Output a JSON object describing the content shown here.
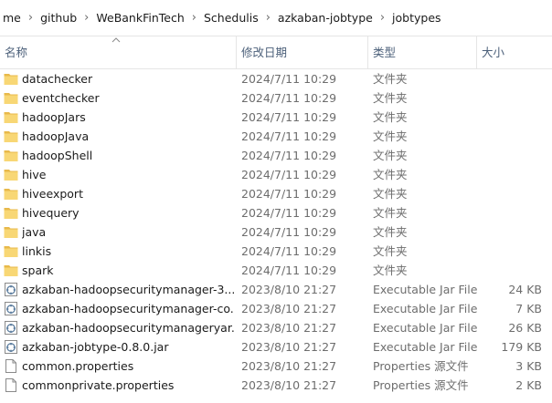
{
  "breadcrumb": [
    "me",
    "github",
    "WeBankFinTech",
    "Schedulis",
    "azkaban-jobtype",
    "jobtypes"
  ],
  "columns": {
    "name": "名称",
    "date": "修改日期",
    "type": "类型",
    "size": "大小"
  },
  "files": [
    {
      "name": "datachecker",
      "date": "2024/7/11 10:29",
      "type": "文件夹",
      "size": "",
      "icon": "folder-icon"
    },
    {
      "name": "eventchecker",
      "date": "2024/7/11 10:29",
      "type": "文件夹",
      "size": "",
      "icon": "folder-icon"
    },
    {
      "name": "hadoopJars",
      "date": "2024/7/11 10:29",
      "type": "文件夹",
      "size": "",
      "icon": "folder-icon"
    },
    {
      "name": "hadoopJava",
      "date": "2024/7/11 10:29",
      "type": "文件夹",
      "size": "",
      "icon": "folder-icon"
    },
    {
      "name": "hadoopShell",
      "date": "2024/7/11 10:29",
      "type": "文件夹",
      "size": "",
      "icon": "folder-icon"
    },
    {
      "name": "hive",
      "date": "2024/7/11 10:29",
      "type": "文件夹",
      "size": "",
      "icon": "folder-icon"
    },
    {
      "name": "hiveexport",
      "date": "2024/7/11 10:29",
      "type": "文件夹",
      "size": "",
      "icon": "folder-icon"
    },
    {
      "name": "hivequery",
      "date": "2024/7/11 10:29",
      "type": "文件夹",
      "size": "",
      "icon": "folder-icon"
    },
    {
      "name": "java",
      "date": "2024/7/11 10:29",
      "type": "文件夹",
      "size": "",
      "icon": "folder-icon"
    },
    {
      "name": "linkis",
      "date": "2024/7/11 10:29",
      "type": "文件夹",
      "size": "",
      "icon": "folder-icon"
    },
    {
      "name": "spark",
      "date": "2024/7/11 10:29",
      "type": "文件夹",
      "size": "",
      "icon": "folder-icon"
    },
    {
      "name": "azkaban-hadoopsecuritymanager-3....",
      "date": "2023/8/10 21:27",
      "type": "Executable Jar File",
      "size": "24 KB",
      "icon": "jar-file-icon"
    },
    {
      "name": "azkaban-hadoopsecuritymanager-co...",
      "date": "2023/8/10 21:27",
      "type": "Executable Jar File",
      "size": "7 KB",
      "icon": "jar-file-icon"
    },
    {
      "name": "azkaban-hadoopsecuritymanageryar...",
      "date": "2023/8/10 21:27",
      "type": "Executable Jar File",
      "size": "26 KB",
      "icon": "jar-file-icon"
    },
    {
      "name": "azkaban-jobtype-0.8.0.jar",
      "date": "2023/8/10 21:27",
      "type": "Executable Jar File",
      "size": "179 KB",
      "icon": "jar-file-icon"
    },
    {
      "name": "common.properties",
      "date": "2023/8/10 21:27",
      "type": "Properties 源文件",
      "size": "3 KB",
      "icon": "properties-file-icon"
    },
    {
      "name": "commonprivate.properties",
      "date": "2023/8/10 21:27",
      "type": "Properties 源文件",
      "size": "2 KB",
      "icon": "properties-file-icon"
    }
  ],
  "colors": {
    "folder": "#f8d775",
    "folder_dark": "#e8b94a",
    "header_text": "#4c607a",
    "secondary_text": "#6d6d6d"
  }
}
